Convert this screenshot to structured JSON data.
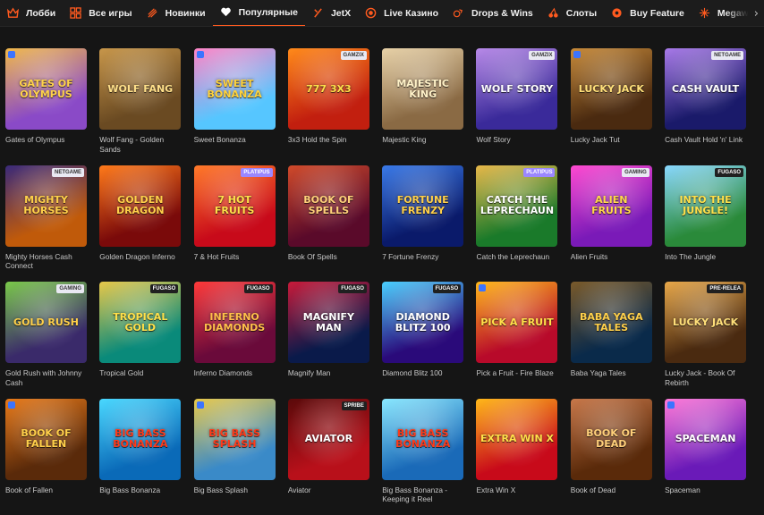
{
  "nav": [
    {
      "label": "Лобби",
      "icon": "crown-icon"
    },
    {
      "label": "Все игры",
      "icon": "grid-icon"
    },
    {
      "label": "Новинки",
      "icon": "sparkle-icon"
    },
    {
      "label": "Популярные",
      "icon": "heart-icon"
    },
    {
      "label": "JetX",
      "icon": "jetx-icon"
    },
    {
      "label": "Live Казино",
      "icon": "live-icon"
    },
    {
      "label": "Drops & Wins",
      "icon": "drops-icon"
    },
    {
      "label": "Слоты",
      "icon": "cherry-icon"
    },
    {
      "label": "Buy Feature",
      "icon": "buy-icon"
    },
    {
      "label": "Megaways",
      "icon": "megaways-icon"
    }
  ],
  "games": [
    {
      "title": "Gates of Olympus",
      "logo": "Gates of Olympus",
      "badge": "",
      "pp": "yes",
      "bg": "#8a4ac7",
      "bg2": "#f0b84a",
      "fg": "#ffd34a"
    },
    {
      "title": "Wolf Fang - Golden Sands",
      "logo": "Wolf Fang",
      "badge": "",
      "pp": "",
      "bg": "#6a4a22",
      "bg2": "#c7964a",
      "fg": "#ffe08a"
    },
    {
      "title": "Sweet Bonanza",
      "logo": "Sweet Bonanza",
      "badge": "",
      "pp": "yes",
      "bg": "#56c6ff",
      "bg2": "#ff84c6",
      "fg": "#ffd23a"
    },
    {
      "title": "3x3 Hold the Spin",
      "logo": "777 3x3",
      "badge": "GAMZIX",
      "pp": "",
      "bg": "#c21f0f",
      "bg2": "#ff8a1a",
      "fg": "#ffe04a"
    },
    {
      "title": "Majestic King",
      "logo": "Majestic King",
      "badge": "",
      "pp": "",
      "bg": "#8a6a44",
      "bg2": "#e8d2a8",
      "fg": "#fff2c8"
    },
    {
      "title": "Wolf Story",
      "logo": "Wolf Story",
      "badge": "GAMZIX",
      "pp": "",
      "bg": "#3a2a9a",
      "bg2": "#b88ae8",
      "fg": "#ffffff"
    },
    {
      "title": "Lucky Jack Tut",
      "logo": "Lucky Jack",
      "badge": "",
      "pp": "yes",
      "bg": "#4a2a10",
      "bg2": "#c78a3a",
      "fg": "#ffe07a"
    },
    {
      "title": "Cash Vault Hold 'n' Link",
      "logo": "Cash Vault",
      "badge": "NETGAME",
      "pp": "",
      "bg": "#1a1a6a",
      "bg2": "#a87ae8",
      "fg": "#ffffff"
    },
    {
      "title": "Mighty Horses Cash Connect",
      "logo": "Mighty Horses",
      "badge": "NETGAME",
      "pp": "",
      "bg": "#c05a0a",
      "bg2": "#3a2a7a",
      "fg": "#ffd04a"
    },
    {
      "title": "Golden Dragon Inferno",
      "logo": "Golden Dragon",
      "badge": "",
      "pp": "",
      "bg": "#7a0a0a",
      "bg2": "#ff7a1a",
      "fg": "#ffd04a"
    },
    {
      "title": "7 & Hot Fruits",
      "logo": "7 Hot Fruits",
      "badge": "Platipus",
      "pp": "",
      "bg": "#c80a1a",
      "bg2": "#ff7a2a",
      "fg": "#ffe04a"
    },
    {
      "title": "Book Of Spells",
      "logo": "Book of Spells",
      "badge": "",
      "pp": "",
      "bg": "#5a0a2a",
      "bg2": "#d04a2a",
      "fg": "#ffd07a"
    },
    {
      "title": "7 Fortune Frenzy",
      "logo": "Fortune Frenzy",
      "badge": "",
      "pp": "",
      "bg": "#0a1a6a",
      "bg2": "#3a7ae8",
      "fg": "#ffd04a"
    },
    {
      "title": "Catch the Leprechaun",
      "logo": "Catch the Leprechaun",
      "badge": "Platipus",
      "pp": "",
      "bg": "#1a7a2a",
      "bg2": "#e8b84a",
      "fg": "#ffffff"
    },
    {
      "title": "Alien Fruits",
      "logo": "Alien Fruits",
      "badge": "GAMING",
      "pp": "",
      "bg": "#7a1ab8",
      "bg2": "#ff4ad0",
      "fg": "#ffd84a"
    },
    {
      "title": "Into The Jungle",
      "logo": "Into the Jungle!",
      "badge": "FUGASO",
      "pp": "",
      "bg": "#2a8a3a",
      "bg2": "#8ad8ff",
      "fg": "#ffe04a"
    },
    {
      "title": "Gold Rush with Johnny Cash",
      "logo": "Gold Rush",
      "badge": "GAMING",
      "pp": "",
      "bg": "#3a2a6a",
      "bg2": "#7ac84a",
      "fg": "#ffd04a"
    },
    {
      "title": "Tropical Gold",
      "logo": "Tropical Gold",
      "badge": "FUGASO",
      "pp": "",
      "bg": "#0a8a7a",
      "bg2": "#e8c84a",
      "fg": "#ffe04a"
    },
    {
      "title": "Inferno Diamonds",
      "logo": "Inferno Diamonds",
      "badge": "FUGASO",
      "pp": "",
      "bg": "#6a0a3a",
      "bg2": "#ff3a3a",
      "fg": "#ffc04a"
    },
    {
      "title": "Magnify Man",
      "logo": "Magnify Man",
      "badge": "FUGASO",
      "pp": "",
      "bg": "#0a1a4a",
      "bg2": "#c81a3a",
      "fg": "#ffffff"
    },
    {
      "title": "Diamond Blitz 100",
      "logo": "Diamond Blitz 100",
      "badge": "FUGASO",
      "pp": "",
      "bg": "#2a0a7a",
      "bg2": "#4ad0ff",
      "fg": "#ffffff"
    },
    {
      "title": "Pick a Fruit - Fire Blaze",
      "logo": "Pick a Fruit",
      "badge": "",
      "pp": "yes",
      "bg": "#b80a2a",
      "bg2": "#ffb81a",
      "fg": "#ffe04a"
    },
    {
      "title": "Baba Yaga Tales",
      "logo": "Baba Yaga Tales",
      "badge": "",
      "pp": "",
      "bg": "#0a2a4a",
      "bg2": "#7a5a2a",
      "fg": "#ffd04a"
    },
    {
      "title": "Lucky Jack - Book Of Rebirth",
      "logo": "Lucky Jack",
      "badge": "Pre-Relea",
      "pp": "",
      "bg": "#4a2a10",
      "bg2": "#e8a84a",
      "fg": "#ffe07a"
    },
    {
      "title": "Book of Fallen",
      "logo": "Book of Fallen",
      "badge": "",
      "pp": "yes",
      "bg": "#5a2a0a",
      "bg2": "#e87a1a",
      "fg": "#ffd04a"
    },
    {
      "title": "Big Bass Bonanza",
      "logo": "Big Bass Bonanza",
      "badge": "",
      "pp": "",
      "bg": "#0a6ab8",
      "bg2": "#4ad8ff",
      "fg": "#ff3a1a"
    },
    {
      "title": "Big Bass Splash",
      "logo": "Big Bass Splash",
      "badge": "",
      "pp": "yes",
      "bg": "#3a8ac8",
      "bg2": "#e8c84a",
      "fg": "#ff3a1a"
    },
    {
      "title": "Aviator",
      "logo": "Aviator",
      "badge": "SPRIBE",
      "pp": "",
      "bg": "#b8101a",
      "bg2": "#5a0a0a",
      "fg": "#ffffff"
    },
    {
      "title": "Big Bass Bonanza - Keeping it Reel",
      "logo": "Big Bass Bonanza",
      "badge": "",
      "pp": "",
      "bg": "#1a6ab8",
      "bg2": "#8ae8ff",
      "fg": "#ff3a1a"
    },
    {
      "title": "Extra Win X",
      "logo": "Extra Win X",
      "badge": "",
      "pp": "",
      "bg": "#c80a1a",
      "bg2": "#ffb81a",
      "fg": "#ffe04a"
    },
    {
      "title": "Book of Dead",
      "logo": "Book of Dead",
      "badge": "",
      "pp": "",
      "bg": "#5a2a0a",
      "bg2": "#c8784a",
      "fg": "#ffd07a"
    },
    {
      "title": "Spaceman",
      "logo": "Spaceman",
      "badge": "",
      "pp": "yes",
      "bg": "#6a1ab8",
      "bg2": "#ff7ad8",
      "fg": "#ffffff"
    }
  ]
}
